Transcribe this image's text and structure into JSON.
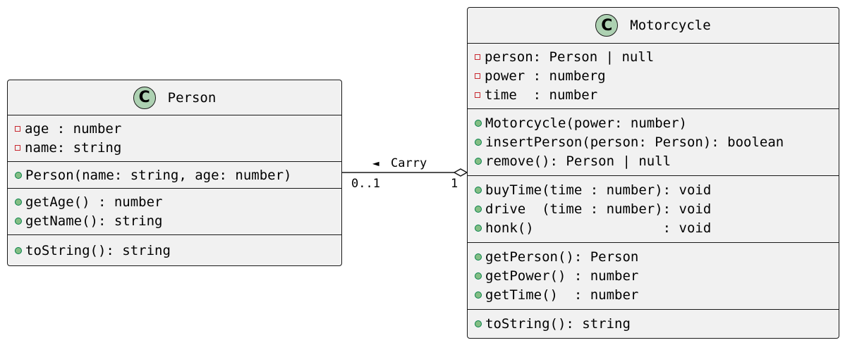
{
  "classes": [
    {
      "name": "Person",
      "badge": "C",
      "sections": [
        [
          {
            "visibility": "private",
            "text": "age : number"
          },
          {
            "visibility": "private",
            "text": "name: string"
          }
        ],
        [
          {
            "visibility": "public",
            "text": "Person(name: string, age: number)"
          }
        ],
        [
          {
            "visibility": "public",
            "text": "getAge() : number"
          },
          {
            "visibility": "public",
            "text": "getName(): string"
          }
        ],
        [
          {
            "visibility": "public",
            "text": "toString(): string"
          }
        ]
      ]
    },
    {
      "name": "Motorcycle",
      "badge": "C",
      "sections": [
        [
          {
            "visibility": "private",
            "text": "person: Person | null"
          },
          {
            "visibility": "private",
            "text": "power : numberg"
          },
          {
            "visibility": "private",
            "text": "time  : number"
          }
        ],
        [
          {
            "visibility": "public",
            "text": "Motorcycle(power: number)"
          },
          {
            "visibility": "public",
            "text": "insertPerson(person: Person): boolean"
          },
          {
            "visibility": "public",
            "text": "remove(): Person | null"
          }
        ],
        [
          {
            "visibility": "public",
            "text": "buyTime(time : number): void"
          },
          {
            "visibility": "public",
            "text": "drive  (time : number): void"
          },
          {
            "visibility": "public",
            "text": "honk()                : void"
          }
        ],
        [
          {
            "visibility": "public",
            "text": "getPerson(): Person"
          },
          {
            "visibility": "public",
            "text": "getPower() : number"
          },
          {
            "visibility": "public",
            "text": "getTime()  : number"
          }
        ],
        [
          {
            "visibility": "public",
            "text": "toString(): string"
          }
        ]
      ]
    }
  ],
  "association": {
    "label": "Carry",
    "direction_arrow": "◄",
    "person_multiplicity": "0..1",
    "motorcycle_multiplicity": "1",
    "type": "aggregation"
  },
  "colors": {
    "class_background": "#f1f1f1",
    "border": "#181818",
    "badge_background": "#add1b2",
    "private_marker": "#c82930",
    "public_marker_fill": "#84be84",
    "public_marker_border": "#038048"
  }
}
